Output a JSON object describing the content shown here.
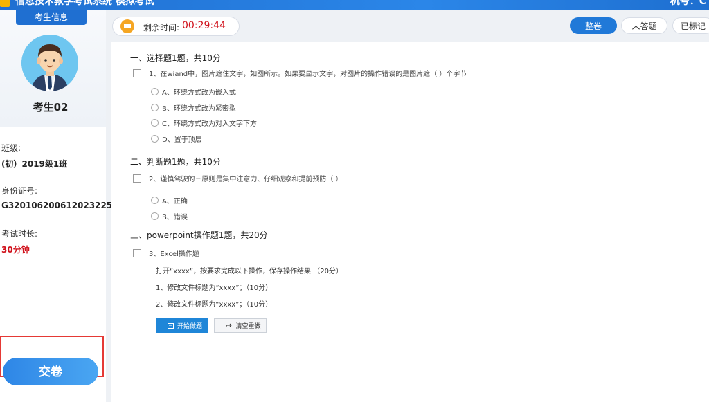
{
  "app": {
    "title": "信息技术教学考试系统 模拟考试",
    "machine_label": "机号：C"
  },
  "sidebar": {
    "tab_label": "考生信息",
    "student_name": "考生02",
    "class_label": "班级:",
    "class_value": "(初）2019级1班",
    "id_label": "身份证号:",
    "id_value": "G320106200612023225",
    "duration_label": "考试时长:",
    "duration_value": "30分钟",
    "submit_label": "交卷"
  },
  "timer": {
    "label": "剩余时间:",
    "value": "00:29:44"
  },
  "toolbar": {
    "whole_label": "整卷",
    "unanswered_label": "未答题",
    "marked_label": "已标记"
  },
  "sections": [
    {
      "title": "一、选择题1题，共10分",
      "question": "1、在wiand中，图片遮住文字，如图所示。如果要显示文字，对图片的操作错误的是图片遮（    ）个字节",
      "options": [
        "A、环绕方式改为嵌入式",
        "B、环绕方式改为紧密型",
        "C、环绕方式改为对入文字下方",
        "D、置于顶层"
      ]
    },
    {
      "title": "二、判断题1题，共10分",
      "question": "2、谨慎驾驶的三原则是集中注意力、仔细观察和提前预防（    ）",
      "options": [
        "A、正确",
        "B、错误"
      ]
    },
    {
      "title": "三、powerpoint操作题1题，共20分",
      "question": "3、Excel操作题",
      "requirements": [
        "打开“xxxx”，按要求完成以下操作，保存操作结果  （20分）",
        "1、修改文件标题为“xxxx”；（10分）",
        "2、修改文件标题为“xxxx”；（10分）"
      ],
      "start_label": "开始做题",
      "clear_label": "清空重做"
    }
  ],
  "colors": {
    "primary": "#2079d8",
    "header": "#1f6fd1",
    "accent_red": "#d0111b",
    "highlight_border": "#e53935"
  },
  "icons": [
    "app-logo-icon",
    "clock-icon",
    "start-icon",
    "reset-icon"
  ]
}
